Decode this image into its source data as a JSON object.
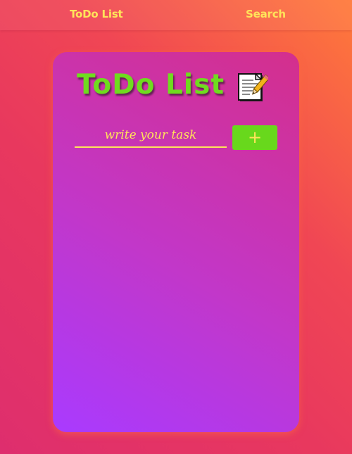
{
  "nav": {
    "todo_label": "ToDo List",
    "search_label": "Search"
  },
  "card": {
    "title": "ToDo List",
    "title_icon": "notepad-pencil-icon"
  },
  "task_input": {
    "value": "",
    "placeholder": "write your task"
  },
  "add_button": {
    "label": "+"
  },
  "colors": {
    "accent_yellow": "#ffe45a",
    "title_green": "#6fdc1f",
    "button_green": "#68d81c",
    "card_purple": "#a93aff",
    "card_pink": "#d42f8c",
    "background_red": "#f04654",
    "background_orange": "#ff7a3a"
  },
  "tasks": []
}
